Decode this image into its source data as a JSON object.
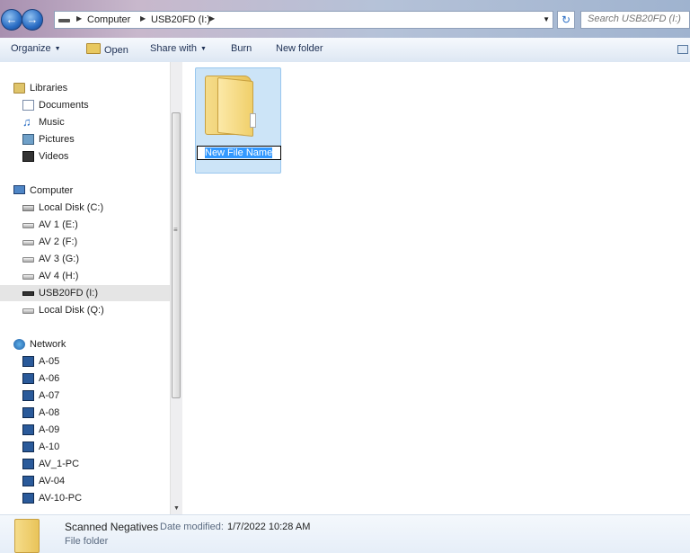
{
  "address": {
    "crumbs": [
      "Computer",
      "USB20FD (I:)"
    ]
  },
  "search": {
    "placeholder": "Search USB20FD (I:)"
  },
  "toolbar": {
    "organize": "Organize",
    "open": "Open",
    "share_with": "Share with",
    "burn": "Burn",
    "new_folder": "New folder"
  },
  "nav": {
    "libraries": "Libraries",
    "library_items": [
      "Documents",
      "Music",
      "Pictures",
      "Videos"
    ],
    "computer": "Computer",
    "drives": [
      "Local Disk (C:)",
      "AV 1 (E:)",
      "AV 2 (F:)",
      "AV 3 (G:)",
      "AV 4 (H:)",
      "USB20FD (I:)",
      "Local Disk (Q:)"
    ],
    "network": "Network",
    "network_items": [
      "A-05",
      "A-06",
      "A-07",
      "A-08",
      "A-09",
      "A-10",
      "AV_1-PC",
      "AV-04",
      "AV-10-PC"
    ]
  },
  "content": {
    "rename_value": "New File Name"
  },
  "details": {
    "name": "Scanned Negatives",
    "modified_label": "Date modified:",
    "modified_value": "1/7/2022 10:28 AM",
    "type": "File folder"
  }
}
